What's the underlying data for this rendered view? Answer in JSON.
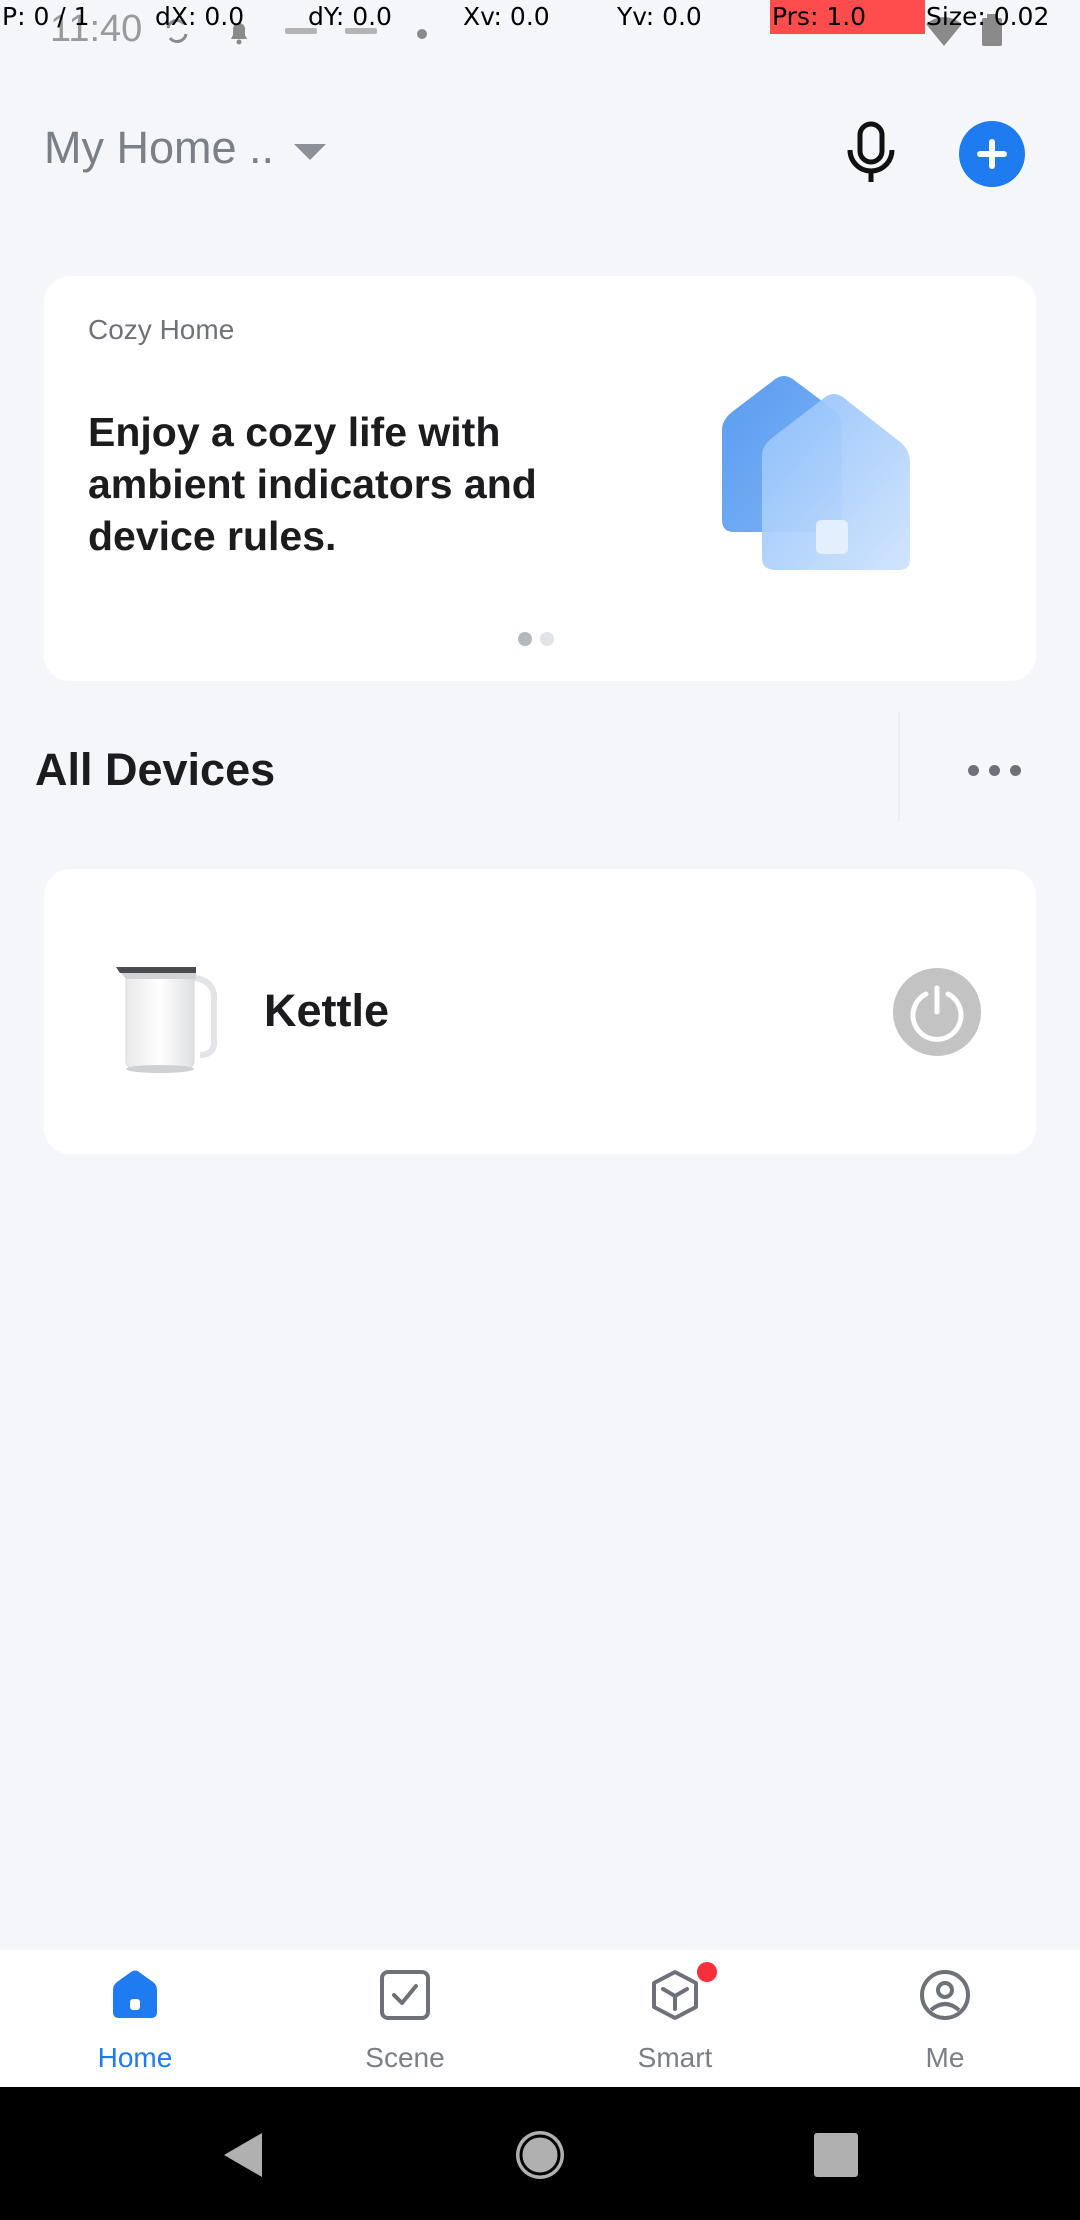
{
  "debug": {
    "pointer": "P: 0 / 1",
    "dx": "dX: 0.0",
    "dy": "dY: 0.0",
    "xv": "Xv: 0.0",
    "yv": "Yv: 0.0",
    "prs": "Prs: 1.0",
    "size": "Size: 0.02"
  },
  "status_bar": {
    "time": "11:40",
    "icons": [
      "sync-icon",
      "notification-bell-icon",
      "wyze-icon",
      "wyze-icon",
      "dot-icon",
      "wifi-icon",
      "battery-icon"
    ]
  },
  "header": {
    "home_name": "My Home ..",
    "icons": [
      "chevron-down-icon",
      "microphone-icon",
      "plus-icon"
    ]
  },
  "banner": {
    "kicker": "Cozy Home",
    "headline": "Enjoy a cozy life with ambient indicators and device rules.",
    "page_count": 2,
    "active_page": 1
  },
  "devices_section": {
    "title": "All Devices"
  },
  "devices": [
    {
      "name": "Kettle",
      "power_on": false
    }
  ],
  "tabbar": {
    "tabs": [
      {
        "label": "Home",
        "icon": "home-icon",
        "active": true
      },
      {
        "label": "Scene",
        "icon": "scene-check-icon",
        "active": false
      },
      {
        "label": "Smart",
        "icon": "smart-cube-icon",
        "active": false,
        "badge": true
      },
      {
        "label": "Me",
        "icon": "profile-icon",
        "active": false
      }
    ]
  },
  "colors": {
    "accent": "#1e7bf0",
    "background": "#f4f6fa",
    "card": "#ffffff",
    "badge": "#f5303b",
    "power_off": "#c3c3c3"
  }
}
